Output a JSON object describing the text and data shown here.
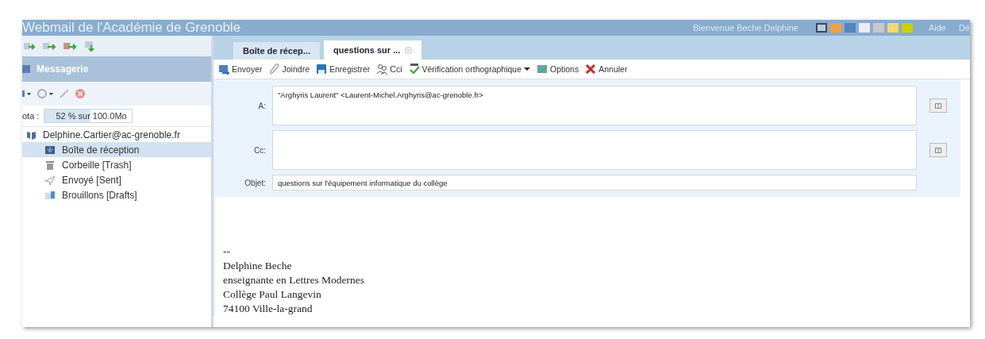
{
  "header": {
    "title": "Webmail de l'Académie de Grenoble",
    "welcome": "Bienvenue Beche Delphine",
    "themes": [
      {
        "color": "#b8cde0",
        "selected": true
      },
      {
        "color": "#f0a040",
        "selected": false
      },
      {
        "color": "#4f86bd",
        "selected": false
      },
      {
        "color": "#e8eef4",
        "selected": false
      },
      {
        "color": "#c8c8c8",
        "selected": false
      },
      {
        "color": "#f5d86a",
        "selected": false
      },
      {
        "color": "#c8d000",
        "selected": false
      }
    ],
    "links": [
      "Aide",
      "Dé"
    ]
  },
  "sidebar": {
    "section": "Messagerie",
    "quota": {
      "label": "ota :",
      "text": "52 % sur 100.0Mo",
      "level": 0.52
    },
    "tree": [
      {
        "label": "Delphine.Cartier@ac-grenoble.fr",
        "kind": "account",
        "selected": false,
        "children": [
          {
            "label": "Boîte de réception",
            "kind": "inbox",
            "selected": true
          },
          {
            "label": "Corbeille [Trash]",
            "kind": "trash",
            "selected": false
          },
          {
            "label": "Envoyé [Sent]",
            "kind": "sent",
            "selected": false
          },
          {
            "label": "Brouillons [Drafts]",
            "kind": "drafts",
            "selected": false
          }
        ]
      }
    ]
  },
  "tabs": [
    {
      "label": "Boîte de récep...",
      "selected": false,
      "closable": false
    },
    {
      "label": "questions sur ...",
      "selected": true,
      "closable": true
    }
  ],
  "toolbar": [
    {
      "label": "Envoyer",
      "kind": "send",
      "has_menu": false
    },
    {
      "label": "Joindre",
      "kind": "attach",
      "has_menu": false
    },
    {
      "label": "Enregistrer",
      "kind": "save",
      "has_menu": false
    },
    {
      "label": "Cci",
      "kind": "bcc",
      "has_menu": false
    },
    {
      "label": "Vérification orthographique",
      "kind": "spell",
      "has_menu": true
    },
    {
      "label": "Options",
      "kind": "options",
      "has_menu": false
    },
    {
      "label": "Annuler",
      "kind": "cancel",
      "has_menu": false
    }
  ],
  "fields": [
    {
      "label": "A:",
      "kind": "area",
      "value": "\"Arghyris Laurent\" <Laurent-Michel.Arghyris@ac-grenoble.fr>",
      "address_book": true
    },
    {
      "label": "Cc:",
      "kind": "area",
      "address_book": true
    },
    {
      "label": "Objet:",
      "kind": "line",
      "value": "questions sur l'équipement informatique du collège",
      "address_book": false
    }
  ],
  "body": [
    "--",
    "Delphine Beche",
    "enseignante en Lettres Modernes",
    "Collège Paul Langevin",
    "74100 Ville-la-grand"
  ]
}
